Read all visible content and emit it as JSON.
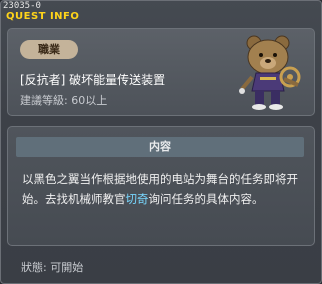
{
  "window": {
    "quest_id": "23035-0",
    "title": "QUEST INFO"
  },
  "quest": {
    "job_label": "職業",
    "name": "[反抗者] 破坏能量传送装置",
    "level": "建議等級: 60以上"
  },
  "content": {
    "header": "内容",
    "desc_part1": "以黑色之翼当作根据地使用的电站为舞台的任务即将开始。去找机械师教官",
    "npc_name": "切奇",
    "desc_part2": "询问任务的具体内容。"
  },
  "status": {
    "text": "狀態:  可開始"
  },
  "colors": {
    "title": "#ffd41a",
    "npc_highlight": "#78d8ff",
    "job_pill": "#c4b39a"
  }
}
